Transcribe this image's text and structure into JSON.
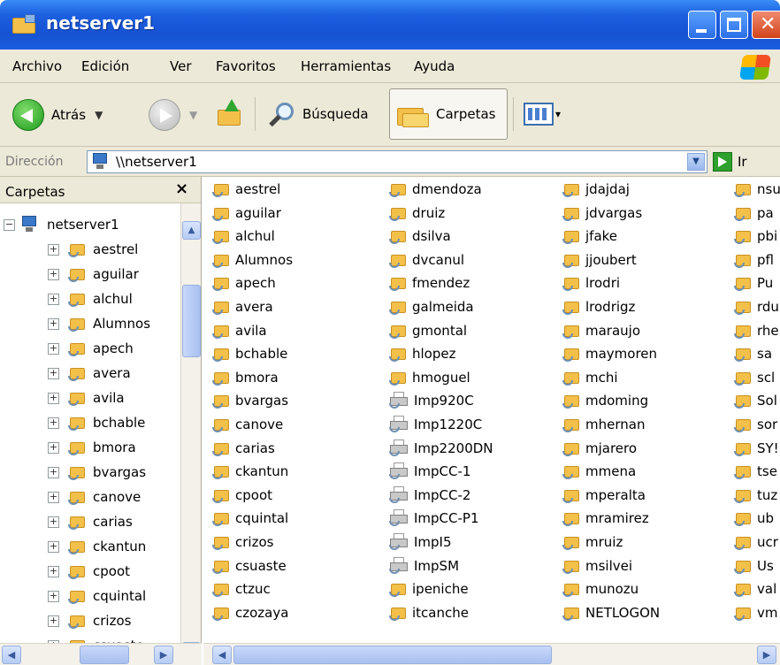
{
  "window": {
    "title": "netserver1"
  },
  "menu": [
    "Archivo",
    "Edición",
    "Ver",
    "Favoritos",
    "Herramientas",
    "Ayuda"
  ],
  "toolbar": {
    "back_label": "Atrás",
    "search_label": "Búsqueda",
    "folders_label": "Carpetas"
  },
  "address": {
    "label": "Dirección",
    "value": "\\\\netserver1",
    "go_label": "Ir"
  },
  "folder_pane": {
    "title": "Carpetas",
    "close_glyph": "×",
    "root": "netserver1",
    "items": [
      "aestrel",
      "aguilar",
      "alchul",
      "Alumnos",
      "apech",
      "avera",
      "avila",
      "bchable",
      "bmora",
      "bvargas",
      "canove",
      "carias",
      "ckantun",
      "cpoot",
      "cquintal",
      "crizos",
      "csuaste"
    ]
  },
  "content": {
    "columns": [
      [
        {
          "name": "aestrel",
          "icon": "share"
        },
        {
          "name": "aguilar",
          "icon": "share"
        },
        {
          "name": "alchul",
          "icon": "share"
        },
        {
          "name": "Alumnos",
          "icon": "share"
        },
        {
          "name": "apech",
          "icon": "share"
        },
        {
          "name": "avera",
          "icon": "share"
        },
        {
          "name": "avila",
          "icon": "share"
        },
        {
          "name": "bchable",
          "icon": "share"
        },
        {
          "name": "bmora",
          "icon": "share"
        },
        {
          "name": "bvargas",
          "icon": "share"
        },
        {
          "name": "canove",
          "icon": "share"
        },
        {
          "name": "carias",
          "icon": "share"
        },
        {
          "name": "ckantun",
          "icon": "share"
        },
        {
          "name": "cpoot",
          "icon": "share"
        },
        {
          "name": "cquintal",
          "icon": "share"
        },
        {
          "name": "crizos",
          "icon": "share"
        },
        {
          "name": "csuaste",
          "icon": "share"
        },
        {
          "name": "ctzuc",
          "icon": "share"
        },
        {
          "name": "czozaya",
          "icon": "share"
        }
      ],
      [
        {
          "name": "dmendoza",
          "icon": "share"
        },
        {
          "name": "druiz",
          "icon": "share"
        },
        {
          "name": "dsilva",
          "icon": "share"
        },
        {
          "name": "dvcanul",
          "icon": "share"
        },
        {
          "name": "fmendez",
          "icon": "share"
        },
        {
          "name": "galmeida",
          "icon": "share"
        },
        {
          "name": "gmontal",
          "icon": "share"
        },
        {
          "name": "hlopez",
          "icon": "share"
        },
        {
          "name": "hmoguel",
          "icon": "share"
        },
        {
          "name": "Imp920C",
          "icon": "printer"
        },
        {
          "name": "Imp1220C",
          "icon": "printer"
        },
        {
          "name": "Imp2200DN",
          "icon": "printer"
        },
        {
          "name": "ImpCC-1",
          "icon": "printer"
        },
        {
          "name": "ImpCC-2",
          "icon": "printer"
        },
        {
          "name": "ImpCC-P1",
          "icon": "printer"
        },
        {
          "name": "ImpI5",
          "icon": "printer"
        },
        {
          "name": "ImpSM",
          "icon": "printer"
        },
        {
          "name": "ipeniche",
          "icon": "share"
        },
        {
          "name": "itcanche",
          "icon": "share"
        }
      ],
      [
        {
          "name": "jdajdaj",
          "icon": "share"
        },
        {
          "name": "jdvargas",
          "icon": "share"
        },
        {
          "name": "jfake",
          "icon": "share"
        },
        {
          "name": "jjoubert",
          "icon": "share"
        },
        {
          "name": "lrodri",
          "icon": "share"
        },
        {
          "name": "lrodrigz",
          "icon": "share"
        },
        {
          "name": "maraujo",
          "icon": "share"
        },
        {
          "name": "maymoren",
          "icon": "share"
        },
        {
          "name": "mchi",
          "icon": "share"
        },
        {
          "name": "mdoming",
          "icon": "share"
        },
        {
          "name": "mhernan",
          "icon": "share"
        },
        {
          "name": "mjarero",
          "icon": "share"
        },
        {
          "name": "mmena",
          "icon": "share"
        },
        {
          "name": "mperalta",
          "icon": "share"
        },
        {
          "name": "mramirez",
          "icon": "share"
        },
        {
          "name": "mruiz",
          "icon": "share"
        },
        {
          "name": "msilvei",
          "icon": "share"
        },
        {
          "name": "munozu",
          "icon": "share"
        },
        {
          "name": "NETLOGON",
          "icon": "share"
        }
      ],
      [
        {
          "name": "nsu",
          "icon": "share"
        },
        {
          "name": "pa",
          "icon": "share"
        },
        {
          "name": "pbi",
          "icon": "share"
        },
        {
          "name": "pfl",
          "icon": "share"
        },
        {
          "name": "Pu",
          "icon": "share"
        },
        {
          "name": "rdu",
          "icon": "share"
        },
        {
          "name": "rhe",
          "icon": "share"
        },
        {
          "name": "sa",
          "icon": "share"
        },
        {
          "name": "scl",
          "icon": "share"
        },
        {
          "name": "Sol",
          "icon": "share"
        },
        {
          "name": "sor",
          "icon": "share"
        },
        {
          "name": "SY!",
          "icon": "share"
        },
        {
          "name": "tse",
          "icon": "share"
        },
        {
          "name": "tuz",
          "icon": "share"
        },
        {
          "name": "ub",
          "icon": "share"
        },
        {
          "name": "ucr",
          "icon": "share"
        },
        {
          "name": "Us",
          "icon": "share"
        },
        {
          "name": "val",
          "icon": "share"
        },
        {
          "name": "vm",
          "icon": "share"
        }
      ]
    ]
  },
  "colors": {
    "titlebar": "#1553d3",
    "chrome": "#ece9d8",
    "folder": "#f3c04a"
  }
}
